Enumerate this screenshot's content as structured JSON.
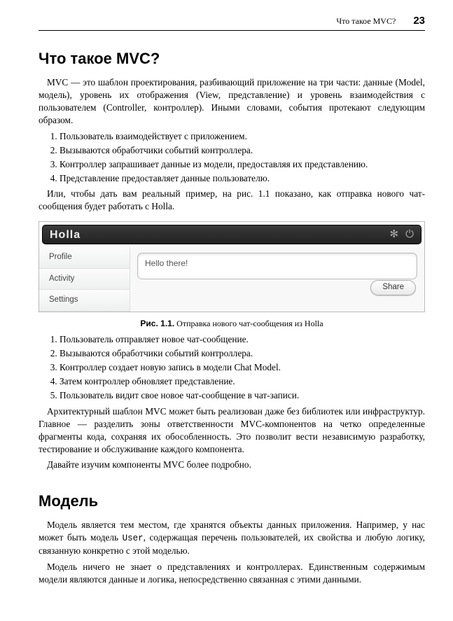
{
  "header": {
    "running_title": "Что такое MVC?",
    "page_number": "23"
  },
  "sections": {
    "mvc_title": "Что такое MVC?",
    "model_title": "Модель"
  },
  "paragraphs": {
    "p1": "MVC — это шаблон проектирования, разбивающий приложение на три части: данные (Model, модель), уровень их отображения (View, представление) и уровень взаимодействия с пользователем (Controller, контроллер). Иными словами, события протекают следующим образом.",
    "p2": "Или, чтобы дать вам реальный пример, на рис. 1.1 показано, как отправка нового чат-сообщения будет работать с Holla.",
    "p3": "Архитектурный шаблон MVC может быть реализован даже без библиотек или инфраструктур. Главное — разделить зоны ответственности MVC-компонентов на четко определенные фрагменты кода, сохраняя их обособленность. Это позволит вести независимую разработку, тестирование и обслуживание каждого компонента.",
    "p4": "Давайте изучим компоненты MVC более подробно.",
    "model_p1a": "Модель является тем местом, где хранятся объекты данных приложения. Например, у нас может быть модель ",
    "model_p1_code": "User",
    "model_p1b": ", содержащая перечень пользователей, их свойства и любую логику, связанную конкретно с этой моделью.",
    "model_p2": "Модель ничего не знает о представлениях и контроллерах. Единственным содержимым модели являются данные и логика, непосредственно связанная с этими данными."
  },
  "list1": [
    "Пользователь взаимодействует с приложением.",
    "Вызываются обработчики событий контроллера.",
    "Контроллер запрашивает данные из модели, предоставляя их представлению.",
    "Представление предоставляет данные пользователю."
  ],
  "list2": [
    "Пользователь отправляет новое чат-сообщение.",
    "Вызываются обработчики событий контроллера.",
    "Контроллер создает новую запись в модели Chat Model.",
    "Затем контроллер обновляет представление.",
    "Пользователь видит свое новое чат-сообщение в чат-записи."
  ],
  "figure": {
    "caption_lead": "Рис. 1.1.",
    "caption_text": " Отправка нового чат-сообщения из Holla",
    "holla": {
      "title": "Holla",
      "sidebar": [
        "Profile",
        "Activity",
        "Settings"
      ],
      "textarea_value": "Hello there!",
      "share_label": "Share"
    }
  }
}
